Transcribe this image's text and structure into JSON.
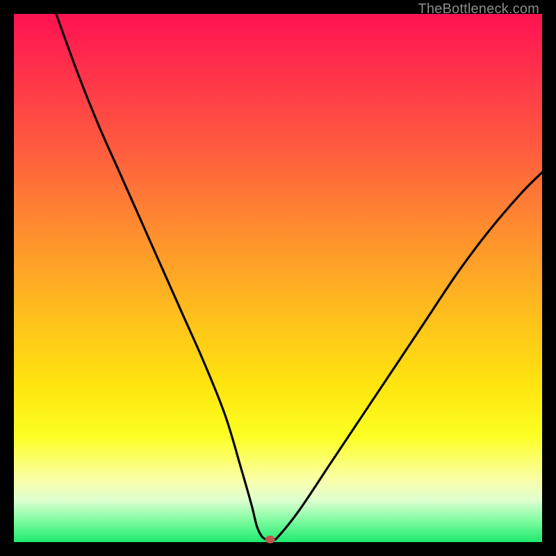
{
  "watermark": "TheBottleneck.com",
  "chart_data": {
    "type": "line",
    "title": "",
    "xlabel": "",
    "ylabel": "",
    "xlim": [
      0,
      100
    ],
    "ylim": [
      0,
      100
    ],
    "series": [
      {
        "name": "curve",
        "x": [
          8,
          12,
          16,
          20,
          24,
          28,
          32,
          36,
          40,
          43,
          45,
          46,
          47,
          48,
          49,
          50,
          54,
          60,
          66,
          72,
          78,
          84,
          90,
          96,
          100
        ],
        "y": [
          100,
          89,
          79,
          70,
          61,
          52,
          43,
          34,
          24,
          14,
          7,
          3,
          1,
          0.5,
          0.5,
          1,
          6,
          15,
          24,
          33,
          42,
          51,
          59,
          66,
          70
        ]
      }
    ],
    "marker": {
      "x": 48.5,
      "y": 0.5,
      "color": "#c0574e"
    },
    "colors": {
      "curve": "#000000",
      "background_top": "#ff1252",
      "background_bottom": "#1de96f",
      "frame": "#000000"
    }
  }
}
